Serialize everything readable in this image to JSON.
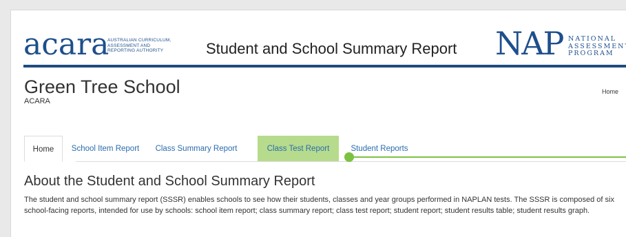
{
  "header": {
    "acara_logo": "acara",
    "acara_logo_lines": [
      "AUSTRALIAN CURRICULUM,",
      "ASSESSMENT AND",
      "REPORTING AUTHORITY"
    ],
    "report_title": "Student and School Summary Report",
    "nap_logo": "NAP",
    "nap_logo_lines": [
      "NATIONAL",
      "ASSESSMENT",
      "PROGRAM"
    ]
  },
  "school": {
    "name": "Green Tree School",
    "org": "ACARA",
    "home_link": "Home"
  },
  "tabs": [
    {
      "label": "Home",
      "state": "active"
    },
    {
      "label": "School Item Report",
      "state": "normal"
    },
    {
      "label": "Class Summary Report",
      "state": "normal"
    },
    {
      "label": "Class Test Report",
      "state": "highlighted"
    },
    {
      "label": "Student Reports",
      "state": "normal"
    }
  ],
  "content": {
    "heading": "About the Student and School Summary Report",
    "body": "The student and school summary report (SSSR) enables schools to see how their students, classes and year groups performed in NAPLAN tests. The SSSR is composed of six school-facing reports, intended for use by schools: school item report; class summary report; class test report; student report; student results table; student results graph."
  },
  "colors": {
    "brand_blue": "#1e4f8c",
    "link_blue": "#2a6cb0",
    "highlight_green": "#b7db8c",
    "indicator_green": "#7cc242"
  }
}
